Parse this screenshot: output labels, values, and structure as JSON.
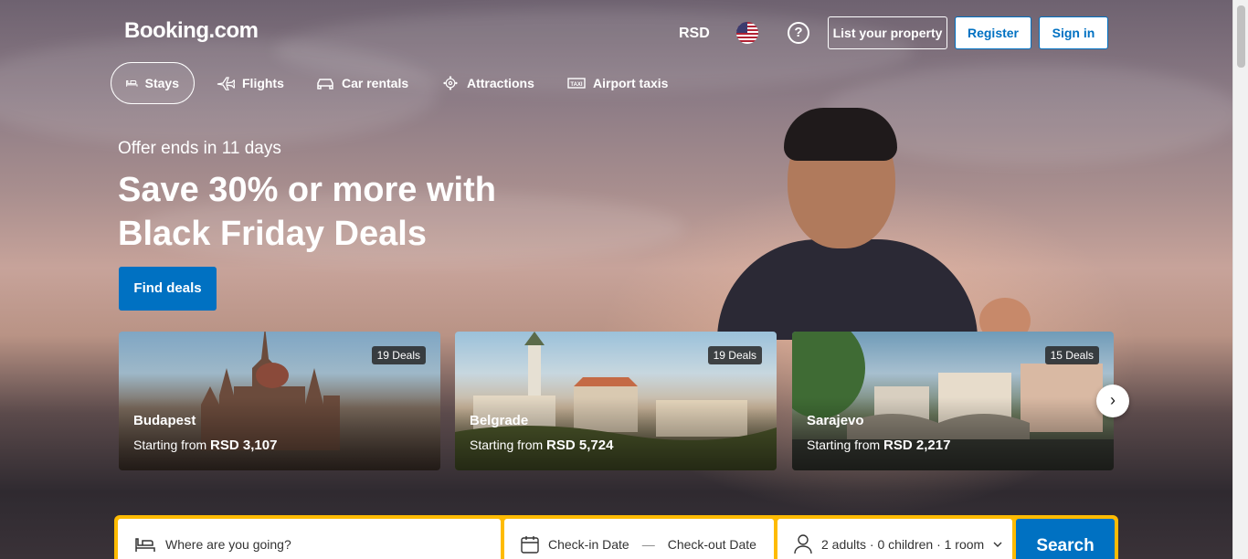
{
  "header": {
    "logo": "Booking.com",
    "currency": "RSD",
    "help_symbol": "?",
    "list_property": "List your property",
    "register": "Register",
    "sign_in": "Sign in"
  },
  "nav": [
    {
      "label": "Stays",
      "icon": "bed-icon",
      "active": true
    },
    {
      "label": "Flights",
      "icon": "plane-icon",
      "active": false
    },
    {
      "label": "Car rentals",
      "icon": "car-icon",
      "active": false
    },
    {
      "label": "Attractions",
      "icon": "ferris-wheel-icon",
      "active": false
    },
    {
      "label": "Airport taxis",
      "icon": "taxi-icon",
      "active": false
    }
  ],
  "hero": {
    "offer": "Offer ends in 11 days",
    "headline_line1": "Save 30% or more with",
    "headline_line2": "Black Friday Deals",
    "cta": "Find deals"
  },
  "deals": [
    {
      "city": "Budapest",
      "deals": "19 Deals",
      "starting": "Starting from",
      "price": "RSD 3,107"
    },
    {
      "city": "Belgrade",
      "deals": "19 Deals",
      "starting": "Starting from",
      "price": "RSD 5,724"
    },
    {
      "city": "Sarajevo",
      "deals": "15 Deals",
      "starting": "Starting from",
      "price": "RSD 2,217"
    }
  ],
  "next_symbol": "›",
  "search": {
    "destination_placeholder": "Where are you going?",
    "checkin": "Check-in Date",
    "dash": "—",
    "checkout": "Check-out Date",
    "guests": "2 adults · 0 children · 1 room",
    "button": "Search"
  },
  "colors": {
    "brand_blue": "#0071c2",
    "search_yellow": "#febb02"
  }
}
